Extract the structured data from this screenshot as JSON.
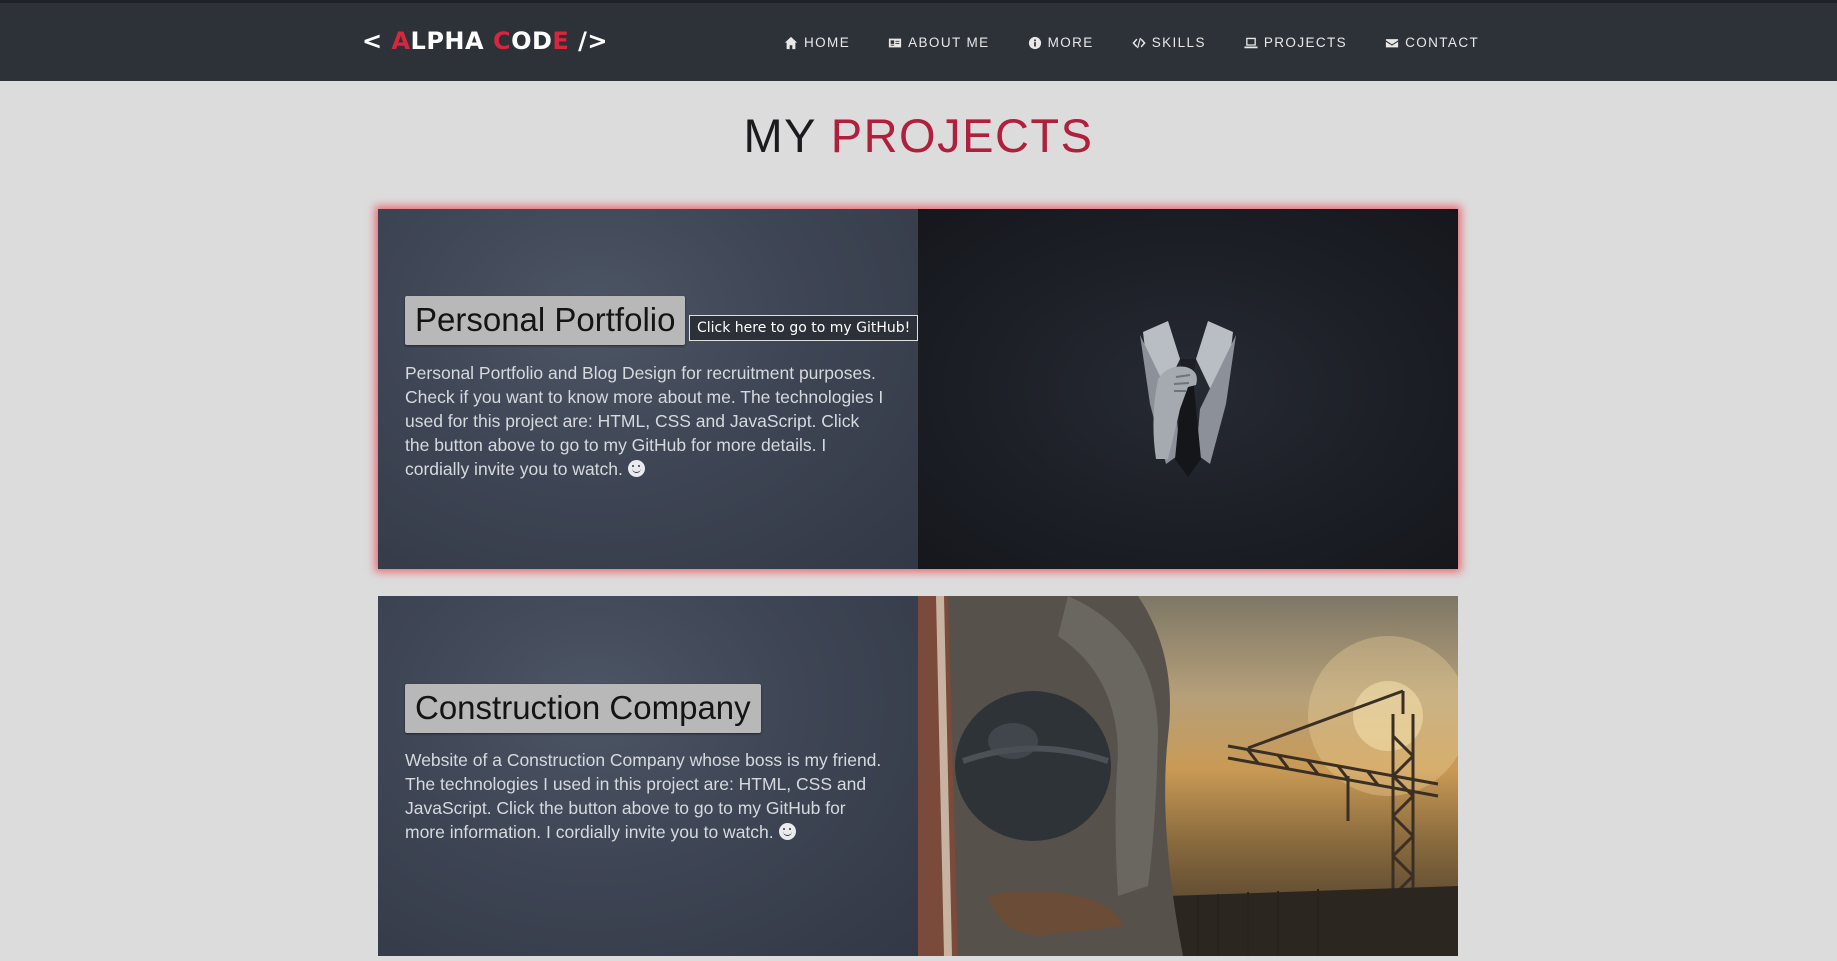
{
  "header": {
    "logo": {
      "open": "< ",
      "a": "A",
      "lpha": "LPHA ",
      "c": "C",
      "od": "OD",
      "e": "E",
      "close": " />"
    },
    "nav": [
      {
        "label": "HOME",
        "icon": "home-icon"
      },
      {
        "label": "ABOUT ME",
        "icon": "id-card-icon"
      },
      {
        "label": "MORE",
        "icon": "info-icon"
      },
      {
        "label": "SKILLS",
        "icon": "code-icon"
      },
      {
        "label": "PROJECTS",
        "icon": "laptop-icon"
      },
      {
        "label": "CONTACT",
        "icon": "envelope-icon"
      }
    ]
  },
  "page": {
    "title_part1": "MY ",
    "title_part2": "PROJECTS"
  },
  "projects": [
    {
      "title": "Personal Portfolio",
      "button": "Click here to go to my GitHub!",
      "description": "Personal Portfolio and Blog Design for recruitment purposes. Check if you want to know more about me. The technologies I used for this project are: HTML, CSS and JavaScript. Click the button above to go to my GitHub for more details. I cordially invite you to watch. ",
      "image": "suit-tie-icon"
    },
    {
      "title": "Construction Company",
      "description": "Website of a Construction Company whose boss is my friend. The technologies I used in this project are: HTML, CSS and JavaScript. Click the button above to go to my GitHub for more information. I cordially invite you to watch. ",
      "image": "construction-worker-photo"
    }
  ],
  "colors": {
    "navbar": "#2d3239",
    "accent": "#b01f3c",
    "logo_accent": "#d7263d",
    "background": "#dcdcdc",
    "card_glow": "#eb4650"
  }
}
